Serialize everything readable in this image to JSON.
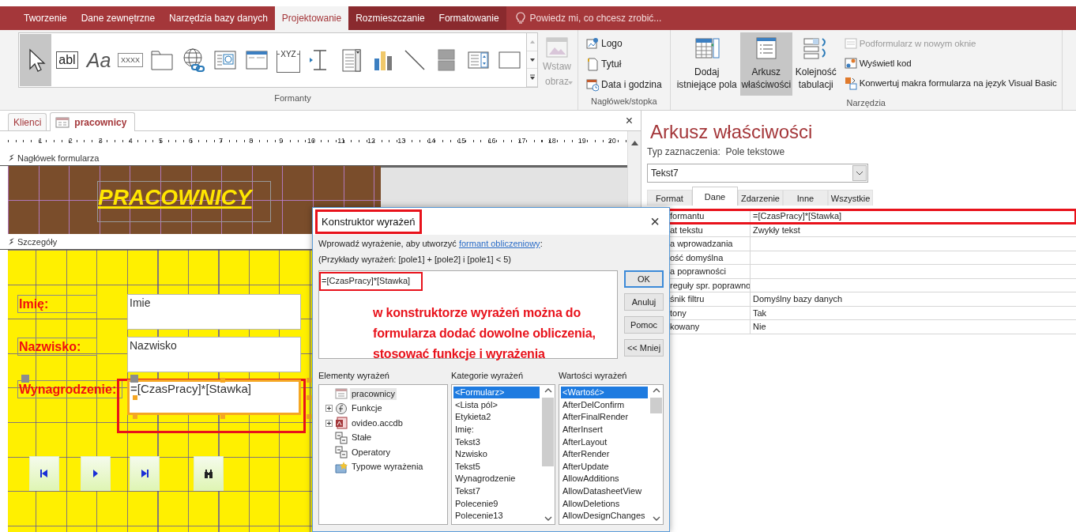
{
  "ribbon": {
    "tabs": [
      {
        "label": "Tworzenie",
        "selected": false,
        "contextual": false
      },
      {
        "label": "Dane zewnętrzne",
        "selected": false,
        "contextual": false
      },
      {
        "label": "Narzędzia bazy danych",
        "selected": false,
        "contextual": false
      },
      {
        "label": "Projektowanie",
        "selected": true,
        "contextual": true
      },
      {
        "label": "Rozmieszczanie",
        "selected": false,
        "contextual": true
      },
      {
        "label": "Formatowanie",
        "selected": false,
        "contextual": true
      }
    ],
    "tell_me": "Powiedz mi, co chcesz zrobić...",
    "controls_group": {
      "label": "Formanty",
      "gallery": [
        {
          "kind": "pointer",
          "selected": true
        },
        {
          "kind": "textbox",
          "glyph": "abl",
          "selected": false
        },
        {
          "kind": "label",
          "glyph": "Aa",
          "selected": false
        },
        {
          "kind": "button",
          "glyph": "XXXX",
          "selected": false
        },
        {
          "kind": "tab",
          "selected": false
        },
        {
          "kind": "hyperlink",
          "selected": false
        },
        {
          "kind": "web",
          "selected": false
        },
        {
          "kind": "navigation",
          "selected": false
        },
        {
          "kind": "option_group",
          "glyph": "XYZ",
          "selected": false
        },
        {
          "kind": "page_break",
          "selected": false
        },
        {
          "kind": "combo",
          "selected": false
        },
        {
          "kind": "chart",
          "selected": false
        },
        {
          "kind": "line",
          "selected": false
        },
        {
          "kind": "toggle",
          "selected": false
        },
        {
          "kind": "listbox",
          "selected": false
        },
        {
          "kind": "rectangle",
          "selected": false
        }
      ],
      "insert_image": {
        "label": "Wstaw obraz",
        "disabled": true
      }
    },
    "header_footer_group": {
      "label": "Nagłówek/stopka",
      "items": [
        {
          "kind": "logo",
          "label": "Logo"
        },
        {
          "kind": "title",
          "label": "Tytuł"
        },
        {
          "kind": "datetime",
          "label": "Data i godzina"
        }
      ]
    },
    "tools_group": {
      "label": "Narzędzia",
      "big_buttons": [
        {
          "kind": "fields",
          "label": "Dodaj istniejące pola",
          "selected": false
        },
        {
          "kind": "sheet",
          "label": "Arkusz właściwości",
          "selected": true
        },
        {
          "kind": "taborder",
          "label": "Kolejność tabulacji",
          "selected": false
        }
      ],
      "small_buttons": [
        {
          "kind": "subform",
          "label": "Podformularz w nowym oknie",
          "disabled": true
        },
        {
          "kind": "code",
          "label": "Wyświetl kod",
          "disabled": false
        },
        {
          "kind": "convert",
          "label": "Konwertuj makra formularza na język Visual Basic",
          "disabled": false
        }
      ]
    }
  },
  "document": {
    "tabs": [
      {
        "label": "Klienci",
        "selected": false
      },
      {
        "label": "pracownicy",
        "selected": true
      }
    ],
    "close": "×",
    "ruler": [
      "1",
      "2",
      "3",
      "4",
      "5",
      "6",
      "7",
      "8",
      "9",
      "10",
      "11",
      "12",
      "13",
      "14",
      "15",
      "16",
      "17",
      "18",
      "19",
      "20"
    ],
    "form_header": {
      "section": "Nagłówek formularza",
      "title": "PRACOWNICY"
    },
    "detail": {
      "section": "Szczegóły",
      "fields": [
        {
          "label": "Imię:",
          "value": "Imie",
          "selected": false,
          "highlighted": false
        },
        {
          "label": "Nazwisko:",
          "value": "Nazwisko",
          "selected": false,
          "highlighted": false
        },
        {
          "label": "Wynagrodzenie:",
          "value": "=[CzasPracy]*[Stawka]",
          "selected": true,
          "highlighted": true
        }
      ],
      "nav_buttons": [
        {
          "kind": "first"
        },
        {
          "kind": "next"
        },
        {
          "kind": "last"
        },
        {
          "kind": "find"
        }
      ]
    }
  },
  "property_sheet": {
    "title": "Arkusz właściwości",
    "selection_type": "Typ zaznaczenia:  Pole tekstowe",
    "object": "Tekst7",
    "tabs": [
      {
        "label": "Format",
        "selected": false
      },
      {
        "label": "Dane",
        "selected": true
      },
      {
        "label": "Zdarzenie",
        "selected": false
      },
      {
        "label": "Inne",
        "selected": false
      },
      {
        "label": "Wszystkie",
        "selected": false
      }
    ],
    "rows": [
      {
        "label": "formantu",
        "value": "=[CzasPracy]*[Stawka]",
        "highlighted": true
      },
      {
        "label": "at tekstu",
        "value": "Zwykły tekst",
        "highlighted": false
      },
      {
        "label": "a wprowadzania",
        "highlighted": false
      },
      {
        "label": "ość domyślna",
        "highlighted": false
      },
      {
        "label": "a poprawności",
        "highlighted": false
      },
      {
        "label": "reguły spr. poprawno",
        "highlighted": false
      },
      {
        "label": "śnik filtru",
        "value": "Domyślny bazy danych",
        "highlighted": false
      },
      {
        "label": "tony",
        "value": "Tak",
        "highlighted": false
      },
      {
        "label": "kowany",
        "value": "Nie",
        "highlighted": false
      }
    ]
  },
  "dialog": {
    "title": "Konstruktor wyrażeń",
    "title_highlighted": true,
    "close": "×",
    "intro": "Wprowadź wyrażenie, aby utworzyć ",
    "intro_link": "formant obliczeniowy",
    "intro_end": ":",
    "example": "(Przykłady wyrażeń: [pole1] + [pole2] i [pole1] < 5)",
    "expression": "=[CzasPracy]*[Stawka]",
    "expression_highlighted": true,
    "annotation": "w konstruktorze wyrażeń można do\nformularza dodać dowolne obliczenia,\nstosować funkcje i wyrażenia",
    "buttons": [
      {
        "label": "OK",
        "default": true
      },
      {
        "label": "Anuluj",
        "default": false
      },
      {
        "label": "Pomoc",
        "default": false
      },
      {
        "label": "<< Mniej",
        "default": false
      }
    ],
    "elements": {
      "heading": "Elementy wyrażeń",
      "items": [
        {
          "kind": "form",
          "label": "pracownicy",
          "collapsed": false,
          "selected": true
        },
        {
          "kind": "function",
          "label": "Funkcje",
          "collapsed": true,
          "selected": false
        },
        {
          "kind": "database",
          "label": "ovideo.accdb",
          "collapsed": true,
          "selected": false
        },
        {
          "kind": "constants",
          "label": "Stałe",
          "collapsed": false,
          "selected": false
        },
        {
          "kind": "constants",
          "label": "Operatory",
          "collapsed": false,
          "selected": false
        },
        {
          "kind": "common",
          "label": "Typowe wyrażenia",
          "collapsed": false,
          "selected": false
        }
      ]
    },
    "categories": {
      "heading": "Kategorie wyrażeń",
      "items": [
        {
          "label": "<Formularz>",
          "selected": true
        },
        {
          "label": "<Lista pól>",
          "selected": false
        },
        {
          "label": "Etykieta2",
          "selected": false
        },
        {
          "label": "Imię:",
          "selected": false
        },
        {
          "label": "Tekst3",
          "selected": false
        },
        {
          "label": "Nzwisko",
          "selected": false
        },
        {
          "label": "Tekst5",
          "selected": false
        },
        {
          "label": "Wynagrodzenie",
          "selected": false
        },
        {
          "label": "Tekst7",
          "selected": false
        },
        {
          "label": "Polecenie9",
          "selected": false
        },
        {
          "label": "Polecenie13",
          "selected": false
        }
      ]
    },
    "values": {
      "heading": "Wartości wyrażeń",
      "items": [
        {
          "label": "<Wartość>",
          "selected": true
        },
        {
          "label": "AfterDelConfirm",
          "selected": false
        },
        {
          "label": "AfterFinalRender",
          "selected": false
        },
        {
          "label": "AfterInsert",
          "selected": false
        },
        {
          "label": "AfterLayout",
          "selected": false
        },
        {
          "label": "AfterRender",
          "selected": false
        },
        {
          "label": "AfterUpdate",
          "selected": false
        },
        {
          "label": "AllowAdditions",
          "selected": false
        },
        {
          "label": "AllowDatasheetView",
          "selected": false
        },
        {
          "label": "AllowDeletions",
          "selected": false
        },
        {
          "label": "AllowDesignChanges",
          "selected": false
        }
      ]
    }
  }
}
